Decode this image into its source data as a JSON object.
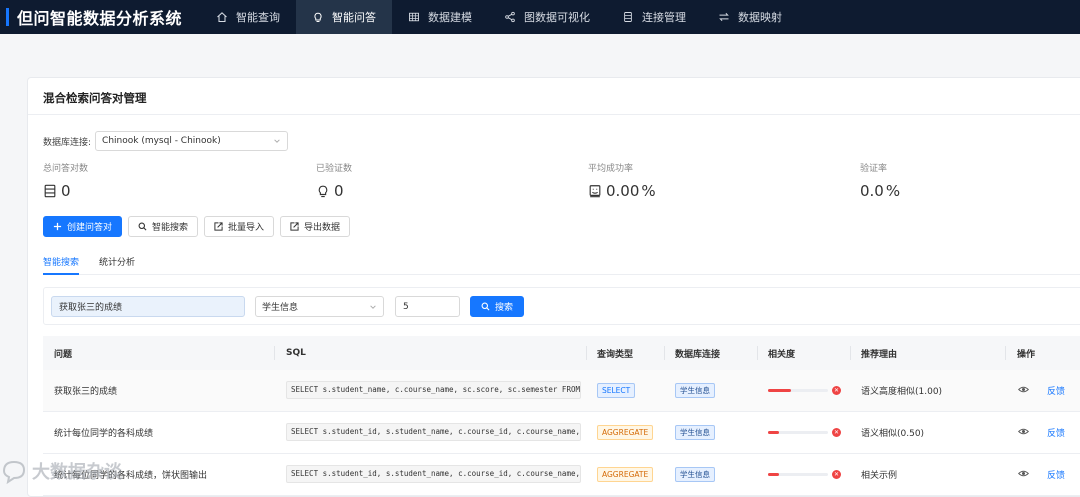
{
  "app": {
    "title": "但问智能数据分析系统"
  },
  "nav": [
    {
      "label": "智能查询",
      "icon": "home-icon"
    },
    {
      "label": "智能问答",
      "icon": "bulb-icon",
      "active": true
    },
    {
      "label": "数据建模",
      "icon": "table-icon"
    },
    {
      "label": "图数据可视化",
      "icon": "share-icon"
    },
    {
      "label": "连接管理",
      "icon": "database-icon"
    },
    {
      "label": "数据映射",
      "icon": "swap-icon"
    }
  ],
  "page": {
    "title": "混合检索问答对管理"
  },
  "db_connection": {
    "label": "数据库连接:",
    "value": "Chinook (mysql - Chinook)"
  },
  "stats": [
    {
      "label": "总问答对数",
      "value": "0",
      "icon": "database-icon"
    },
    {
      "label": "已验证数",
      "value": "0",
      "icon": "bulb-icon"
    },
    {
      "label": "平均成功率",
      "value": "0.00",
      "unit": "%",
      "icon": "trophy-icon"
    },
    {
      "label": "验证率",
      "value": "0.0",
      "unit": "%",
      "icon": "none"
    }
  ],
  "actions": {
    "create": "创建问答对",
    "smart_search": "智能搜索",
    "batch_import": "批量导入",
    "export": "导出数据"
  },
  "tabs": [
    {
      "label": "智能搜索",
      "active": true
    },
    {
      "label": "统计分析",
      "active": false
    }
  ],
  "search": {
    "query": "获取张三的成绩",
    "category": "学生信息",
    "top_k": "5",
    "button": "搜索"
  },
  "table": {
    "columns": [
      "问题",
      "SQL",
      "查询类型",
      "数据库连接",
      "相关度",
      "推荐理由",
      "操作"
    ],
    "rows": [
      {
        "question": "获取张三的成绩",
        "sql": "SELECT s.student_name, c.course_name, sc.score, sc.semester FROM s...",
        "type": "SELECT",
        "type_color": "blue",
        "db": "学生信息",
        "relevance": 0.38,
        "reason": "语义高度相似(1.00)",
        "action": "反馈"
      },
      {
        "question": "统计每位同学的各科成绩",
        "sql": "SELECT s.student_id, s.student_name, c.course_id, c.course_name, s...",
        "type": "AGGREGATE",
        "type_color": "orange",
        "db": "学生信息",
        "relevance": 0.18,
        "reason": "语义相似(0.50)",
        "action": "反馈"
      },
      {
        "question": "统计每位同学的各科成绩，饼状图输出",
        "sql": "SELECT s.student_id, s.student_name, c.course_id, c.course_name, s...",
        "type": "AGGREGATE",
        "type_color": "orange",
        "db": "学生信息",
        "relevance": 0.18,
        "reason": "相关示例",
        "action": "反馈"
      }
    ]
  },
  "watermark": {
    "text": "大数据杂谈"
  }
}
